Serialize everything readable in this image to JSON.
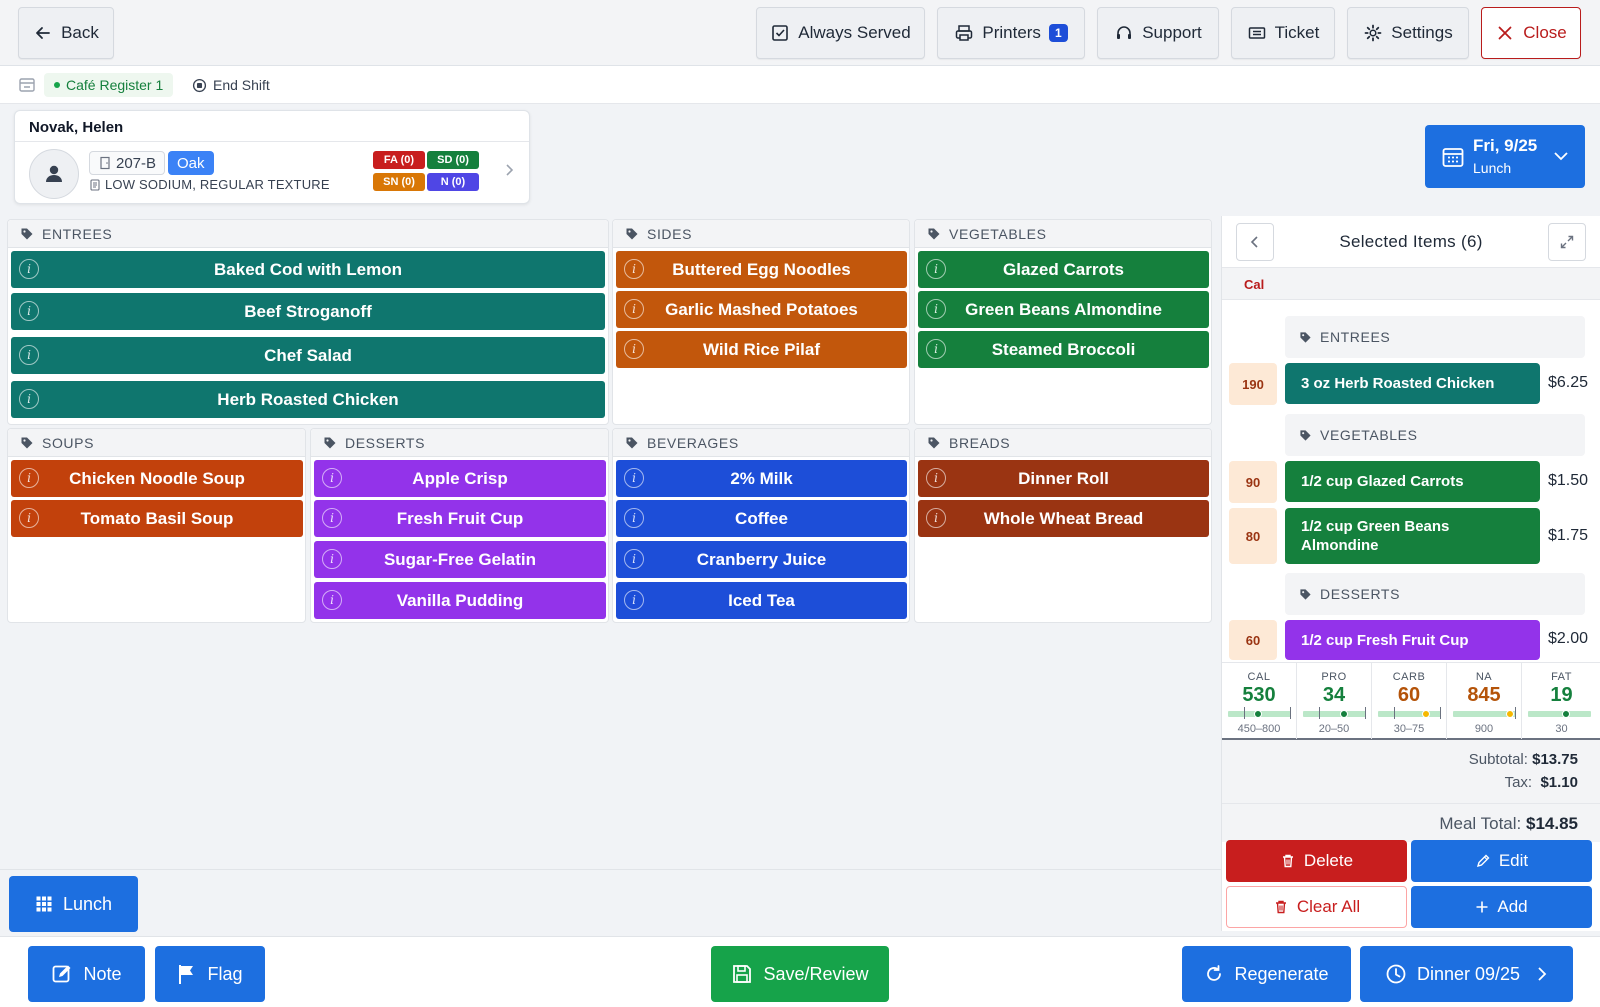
{
  "topbar": {
    "back": "Back",
    "always_served": "Always Served",
    "printers": "Printers",
    "printers_count": "1",
    "support": "Support",
    "ticket": "Ticket",
    "settings": "Settings",
    "close": "Close"
  },
  "subbar": {
    "register": "Café Register 1",
    "end_shift": "End Shift"
  },
  "patient": {
    "name": "Novak, Helen",
    "room": "207-B",
    "unit": "Oak",
    "diet": "LOW SODIUM, REGULAR TEXTURE",
    "flags": [
      {
        "label": "FA (0)",
        "color": "#c81e1e"
      },
      {
        "label": "SD (0)",
        "color": "#15803d"
      },
      {
        "label": "SN (0)",
        "color": "#d97706"
      },
      {
        "label": "N (0)",
        "color": "#4f46e5"
      }
    ]
  },
  "date_selector": {
    "day": "Fri, 9/25",
    "meal": "Lunch"
  },
  "menu": {
    "entrees": {
      "title": "ENTREES",
      "items": [
        "Baked Cod with Lemon",
        "Beef Stroganoff",
        "Chef Salad",
        "Herb Roasted Chicken"
      ]
    },
    "sides": {
      "title": "SIDES",
      "items": [
        "Buttered Egg Noodles",
        "Garlic Mashed Potatoes",
        "Wild Rice Pilaf"
      ]
    },
    "vegetables": {
      "title": "VEGETABLES",
      "items": [
        "Glazed Carrots",
        "Green Beans Almondine",
        "Steamed Broccoli"
      ]
    },
    "soups": {
      "title": "SOUPS",
      "items": [
        "Chicken Noodle Soup",
        "Tomato Basil Soup"
      ]
    },
    "desserts": {
      "title": "DESSERTS",
      "items": [
        "Apple Crisp",
        "Fresh Fruit Cup",
        "Sugar-Free Gelatin",
        "Vanilla Pudding"
      ]
    },
    "beverages": {
      "title": "BEVERAGES",
      "items": [
        "2% Milk",
        "Coffee",
        "Cranberry Juice",
        "Iced Tea"
      ]
    },
    "breads": {
      "title": "BREADS",
      "items": [
        "Dinner Roll",
        "Whole Wheat Bread"
      ]
    }
  },
  "selected": {
    "title": "Selected Items (6)",
    "cal_header": "Cal",
    "groups": [
      {
        "category": "ENTREES",
        "items": [
          {
            "cal": "190",
            "name": "3 oz Herb Roasted Chicken",
            "price": "$6.25",
            "color": "#0f766e"
          }
        ]
      },
      {
        "category": "VEGETABLES",
        "items": [
          {
            "cal": "90",
            "name": "1/2 cup Glazed Carrots",
            "price": "$1.50",
            "color": "#15803d"
          },
          {
            "cal": "80",
            "name": "1/2 cup Green Beans Almondine",
            "price": "$1.75",
            "color": "#15803d"
          }
        ]
      },
      {
        "category": "DESSERTS",
        "items": [
          {
            "cal": "60",
            "name": "1/2 cup Fresh Fruit Cup",
            "price": "$2.00",
            "color": "#9333ea"
          }
        ]
      }
    ],
    "nutrition": [
      {
        "label": "CAL",
        "value": "530",
        "range": "450–800",
        "color": "#15803d",
        "marker_color": "#15803d"
      },
      {
        "label": "PRO",
        "value": "34",
        "range": "20–50",
        "color": "#15803d",
        "marker_color": "#15803d"
      },
      {
        "label": "CARB",
        "value": "60",
        "range": "30–75",
        "color": "#b45309",
        "marker_color": "#f5b800"
      },
      {
        "label": "NA",
        "value": "845",
        "range": "900",
        "color": "#b45309",
        "marker_color": "#f5b800"
      },
      {
        "label": "FAT",
        "value": "19",
        "range": "30",
        "color": "#15803d",
        "marker_color": "#15803d"
      }
    ],
    "subtotal_label": "Subtotal:",
    "subtotal": "$13.75",
    "tax_label": "Tax:",
    "tax": "$1.10",
    "meal_total_label": "Meal Total:",
    "meal_total": "$14.85",
    "actions": {
      "delete": "Delete",
      "edit": "Edit",
      "clear_all": "Clear All",
      "add": "Add"
    }
  },
  "meal_button": "Lunch",
  "bottombar": {
    "note": "Note",
    "flag": "Flag",
    "save_review": "Save/Review",
    "regenerate": "Regenerate",
    "next_meal": "Dinner 09/25"
  }
}
